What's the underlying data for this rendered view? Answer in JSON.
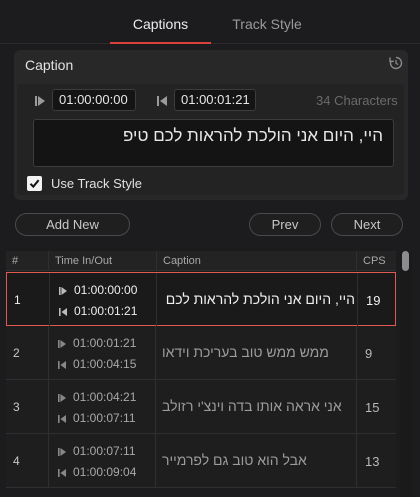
{
  "tabs": [
    {
      "label": "Captions",
      "active": true
    },
    {
      "label": "Track Style",
      "active": false
    }
  ],
  "caption_panel": {
    "title": "Caption",
    "time_in": "01:00:00:00",
    "time_out": "01:00:01:21",
    "char_count": "34 Characters",
    "text": "היי, היום אני הולכת להראות לכם טיפ",
    "use_track_style_label": "Use Track Style",
    "use_track_style_checked": true
  },
  "buttons": {
    "add_new": "Add New",
    "prev": "Prev",
    "next": "Next"
  },
  "table": {
    "headers": {
      "num": "#",
      "time": "Time In/Out",
      "caption": "Caption",
      "cps": "CPS"
    },
    "rows": [
      {
        "num": "1",
        "in": "01:00:00:00",
        "out": "01:00:01:21",
        "caption": "היי, היום אני הולכת להראות לכם טיפ",
        "cps": "19",
        "selected": true
      },
      {
        "num": "2",
        "in": "01:00:01:21",
        "out": "01:00:04:15",
        "caption": "ממש ממש טוב בעריכת וידאו",
        "cps": "9",
        "selected": false
      },
      {
        "num": "3",
        "in": "01:00:04:21",
        "out": "01:00:07:11",
        "caption": "אני אראה אותו בדה וינצ'י רזולב",
        "cps": "15",
        "selected": false
      },
      {
        "num": "4",
        "in": "01:00:07:11",
        "out": "01:00:09:04",
        "caption": "אבל הוא טוב גם לפרמייר",
        "cps": "13",
        "selected": false
      }
    ]
  },
  "colors": {
    "accent": "#d9423a",
    "selection_border": "#e05a52",
    "background": "#1c1c1e"
  },
  "icons": [
    "reset-icon",
    "mark-in-icon",
    "mark-out-icon",
    "checkmark-icon"
  ]
}
